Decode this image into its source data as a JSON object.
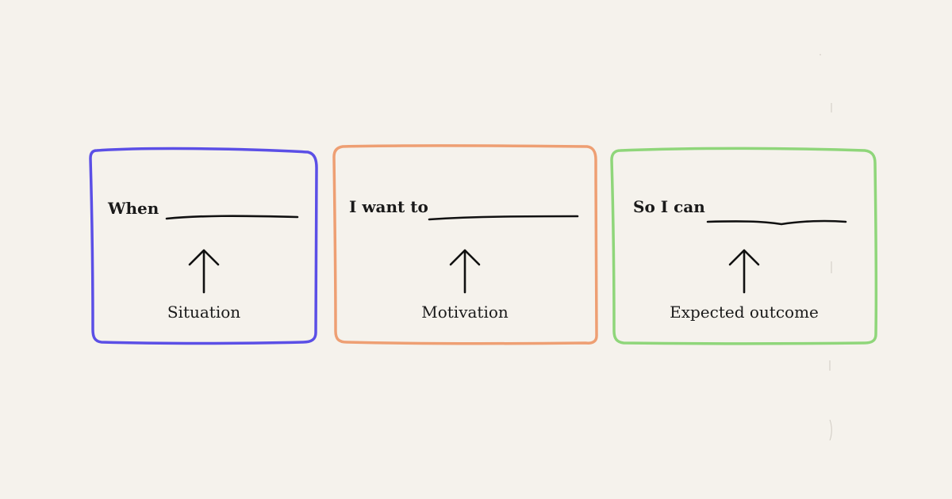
{
  "colors": {
    "background": "#f5f2ec",
    "text": "#1a1a1a",
    "situation_frame": "#5b4fe6",
    "motivation_frame": "#ee9f73",
    "outcome_frame": "#8fd67a"
  },
  "cards": [
    {
      "prompt": "When",
      "caption": "Situation",
      "frame_color": "#5b4fe6",
      "arrow_icon": "arrow-up-icon"
    },
    {
      "prompt": "I want to",
      "caption": "Motivation",
      "frame_color": "#ee9f73",
      "arrow_icon": "arrow-up-icon"
    },
    {
      "prompt": "So I can",
      "caption": "Expected outcome",
      "frame_color": "#8fd67a",
      "arrow_icon": "arrow-up-icon"
    }
  ]
}
